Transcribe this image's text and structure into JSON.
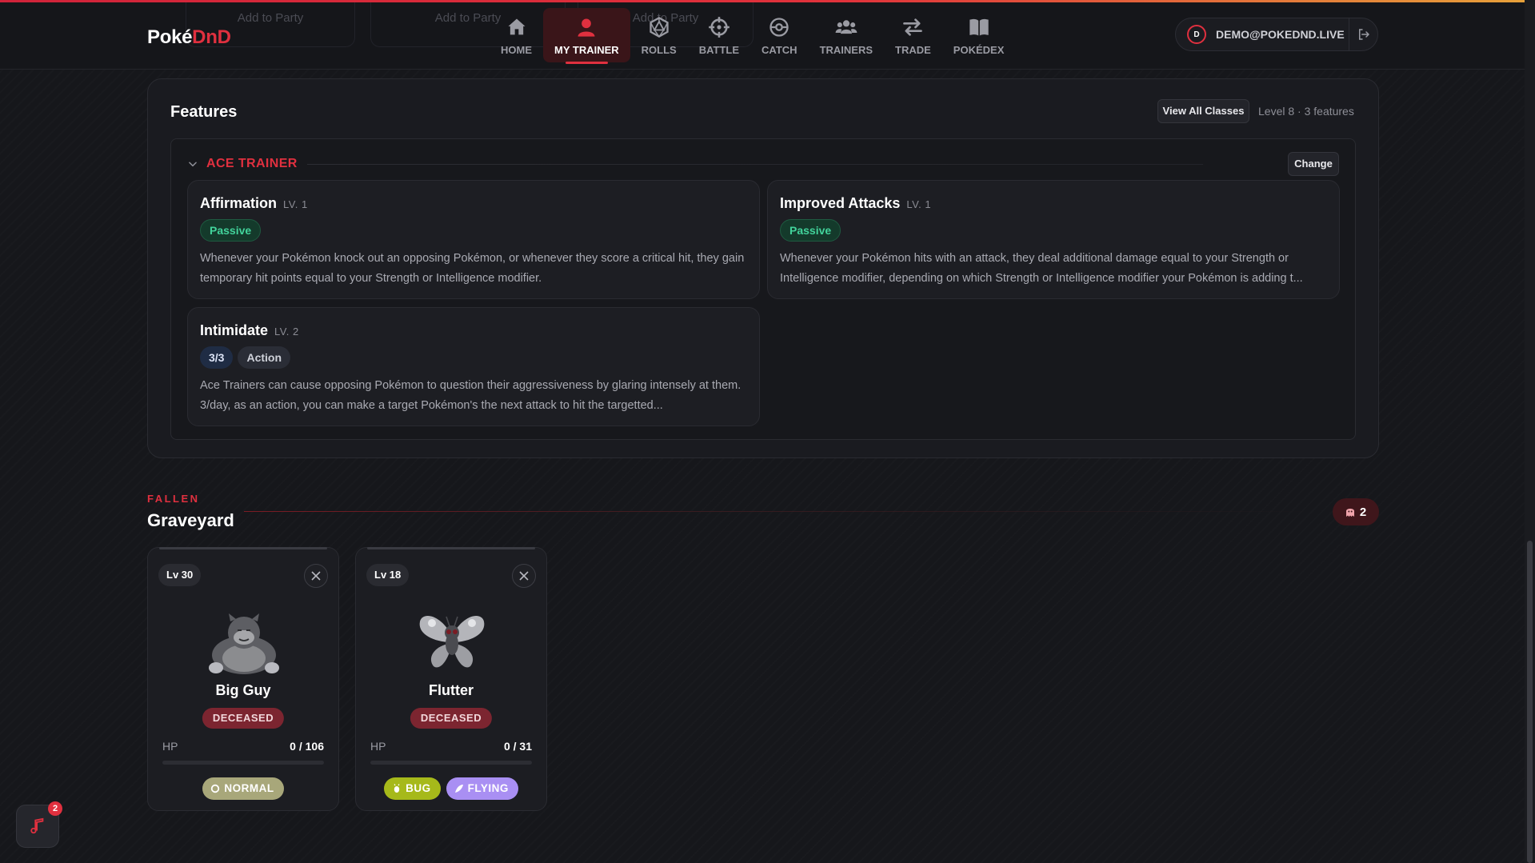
{
  "app": {
    "logo_main": "Poké",
    "logo_accent": "DnD"
  },
  "ghost_buttons": [
    "Add to Party",
    "Add to Party",
    "Add to Party"
  ],
  "nav": [
    {
      "label": "HOME",
      "icon": "home-icon",
      "active": false
    },
    {
      "label": "MY TRAINER",
      "icon": "trainer-icon",
      "active": true
    },
    {
      "label": "ROLLS",
      "icon": "dice-icon",
      "active": false
    },
    {
      "label": "BATTLE",
      "icon": "crosshair-icon",
      "active": false
    },
    {
      "label": "CATCH",
      "icon": "pokeball-icon",
      "active": false
    },
    {
      "label": "TRAINERS",
      "icon": "users-icon",
      "active": false
    },
    {
      "label": "TRADE",
      "icon": "swap-icon",
      "active": false
    },
    {
      "label": "POKÉDEX",
      "icon": "book-icon",
      "active": false
    }
  ],
  "user": {
    "initial": "D",
    "email": "DEMO@POKEDND.LIVE"
  },
  "features": {
    "title": "Features",
    "view_all_label": "View All Classes",
    "level_info": "Level 8 · 3 features",
    "class_section": {
      "name": "ACE TRAINER",
      "change_label": "Change",
      "items": [
        {
          "name": "Affirmation",
          "level": "LV. 1",
          "tags": [
            {
              "label": "Passive",
              "kind": "passive"
            }
          ],
          "description": "Whenever your Pokémon knock out an opposing Pokémon, or whenever they score a critical hit, they gain temporary hit points equal to your Strength or Intelligence modifier."
        },
        {
          "name": "Improved Attacks",
          "level": "LV. 1",
          "tags": [
            {
              "label": "Passive",
              "kind": "passive"
            }
          ],
          "description": "Whenever your Pokémon hits with an attack, they deal additional damage equal to your Strength or Intelligence modifier, depending on which Strength or Intelligence modifier your Pokémon is adding t..."
        },
        {
          "name": "Intimidate",
          "level": "LV. 2",
          "tags": [
            {
              "label": "3/3",
              "kind": "uses"
            },
            {
              "label": "Action",
              "kind": "action"
            }
          ],
          "description": "Ace Trainers can cause opposing Pokémon to question their aggressiveness by glaring intensely at them. 3/day, as an action, you can make a target Pokémon's the next attack to hit the targetted..."
        }
      ]
    }
  },
  "graveyard": {
    "eyebrow": "FALLEN",
    "title": "Graveyard",
    "count": "2",
    "count_icon": "ghost-icon",
    "pokemon": [
      {
        "level": "Lv 30",
        "name": "Big Guy",
        "status": "DECEASED",
        "sprite": "snorlax-sprite",
        "hp_label": "HP",
        "hp": "0 / 106",
        "hp_fraction": 0,
        "types": [
          {
            "label": "NORMAL",
            "color": "#a8a77a",
            "icon": "normal-type-icon"
          }
        ]
      },
      {
        "level": "Lv 18",
        "name": "Flutter",
        "status": "DECEASED",
        "sprite": "butterfree-sprite",
        "hp_label": "HP",
        "hp": "0 / 31",
        "hp_fraction": 0,
        "types": [
          {
            "label": "BUG",
            "color": "#a6b91a",
            "icon": "bug-type-icon"
          },
          {
            "label": "FLYING",
            "color": "#a98ff3",
            "icon": "flying-type-icon"
          }
        ]
      }
    ]
  },
  "music": {
    "badge": "2",
    "icon": "music-note-icon"
  },
  "colors": {
    "accent": "#e0303f",
    "passive": "#42d39b",
    "deceased": "#7c2530"
  }
}
